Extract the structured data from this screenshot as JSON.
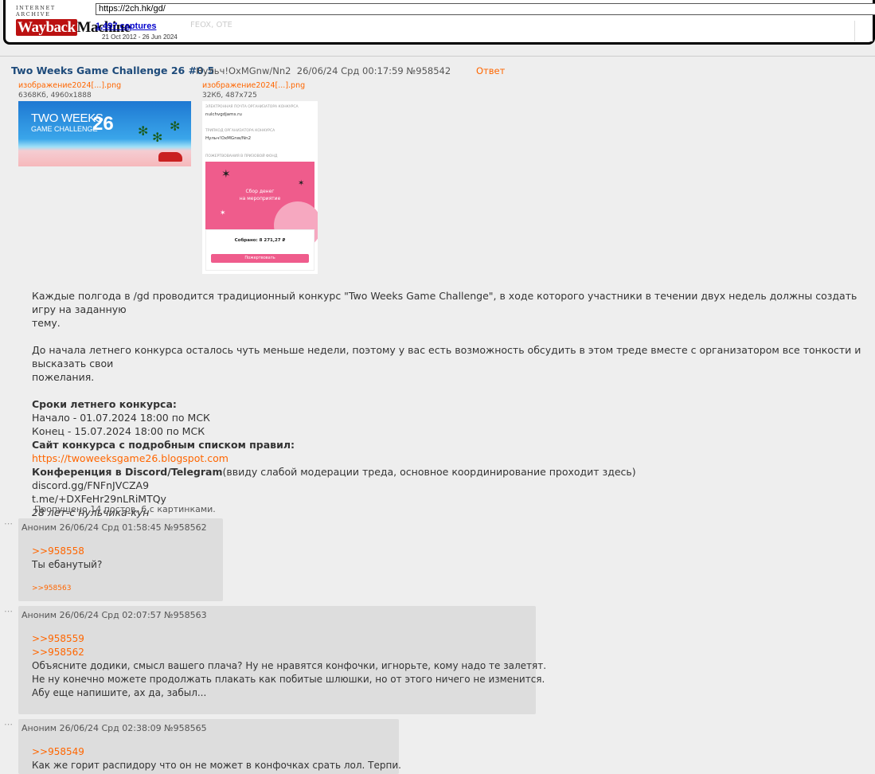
{
  "wayback": {
    "logo_top": "INTERNET ARCHIVE",
    "logo_main_1": "Wayback",
    "logo_main_2": "Machine",
    "url": "https://2ch.hk/gd/",
    "captures": "1,497 captures",
    "date_range": "21 Oct 2012 - 26 Jun 2024",
    "ghost_text": "FEOX, OTE"
  },
  "op": {
    "title": "Two Weeks Game Challenge 26 #0.5",
    "author": "Нульч!OxMGnw/Nn2",
    "datetime": "26/06/24 Срд 00:17:59",
    "post_number": "№958542",
    "reply_label": "Ответ",
    "files": [
      {
        "name": "изображение2024[...].png",
        "info": "6368Кб, 4960x1888",
        "image_text_1": "TWO WEEKS",
        "image_text_2": "GAME CHALLENGE",
        "image_text_3": "26"
      },
      {
        "name": "изображение2024[...].png",
        "info": "32Кб, 487x725",
        "email_label": "ЭЛЕКТРОННАЯ ПОЧТА ОРГАНИЗАТОРА КОНКУРСА",
        "email_value": "nulchvgdjams.ru",
        "org_label": "ТРИПКОД ОРГАНИЗАТОРА КОНКУРСА",
        "org_value": "Нульч!OxMGnw/Nn2",
        "donate_label": "ПОЖЕРТВОВАНИЯ В ПРИЗОВОЙ ФОНД",
        "banner_1": "Сбор денег",
        "banner_2": "на мероприятие",
        "collected": "Собрано: 8 271,27 ₽",
        "button": "Пожертвовать"
      }
    ],
    "body": {
      "p1": "Каждые полгода в /gd проводится традиционный конкурс \"Two Weeks Game Challenge\", в ходе которого участники в течении двух недель должны создать игру на заданную",
      "p1b": "тему.",
      "p2": "До начала летнего конкурса осталось чуть меньше недели, поэтому у вас есть возможность обсудить в этом треде вместе с организатором все тонкости и высказать свои",
      "p2b": "пожелания.",
      "terms_heading": "Сроки летнего конкурса:",
      "start": "Начало - 01.07.2024 18:00 по МСК",
      "end": "Конец - 15.07.2024 18:00 по МСК",
      "site_heading": "Сайт конкурса с подробным списком правил:",
      "site_link": "https://twoweeksgame26.blogspot.com",
      "conf_heading": "Конференция в Discord/Telegram",
      "conf_note": "(ввиду слабой модерации треда, основное координирование проходит здесь)",
      "discord": "discord.gg/FNFnJVCZA9",
      "telegram": "t.me/+DXFeHr29nLRiMTQy",
      "signature": "28 лет-с нульчика-кун"
    }
  },
  "skipped": "Пропущено 14 постов, 6 с картинками.",
  "replies": [
    {
      "meta": "Аноним 26/06/24 Срд 01:58:45 №958562",
      "quotes": [
        ">>958558"
      ],
      "lines": [
        "Ты ебанутый?"
      ],
      "backref": ">>958563"
    },
    {
      "meta": "Аноним 26/06/24 Срд 02:07:57 №958563",
      "quotes": [
        ">>958559",
        ">>958562"
      ],
      "lines": [
        "Объясните додики, смысл вашего плача? Ну не нравятся конфочки, игнорьте, кому надо те залетят.",
        "Не ну конечно можете продолжать плакать как побитые шлюшки, но от этого ничего не изменится.",
        "Абу еще напишите, ах да, забыл..."
      ]
    },
    {
      "meta": "Аноним 26/06/24 Срд 02:38:09 №958565",
      "quotes": [
        ">>958549"
      ],
      "lines": [
        "Как же горит распидору что он не может в конфочках срать лол. Терпи."
      ]
    }
  ],
  "colors": {
    "background": "#eeeeee",
    "reply_bg": "#dddddd",
    "link": "#ff6600",
    "title": "#1d4a7a"
  }
}
